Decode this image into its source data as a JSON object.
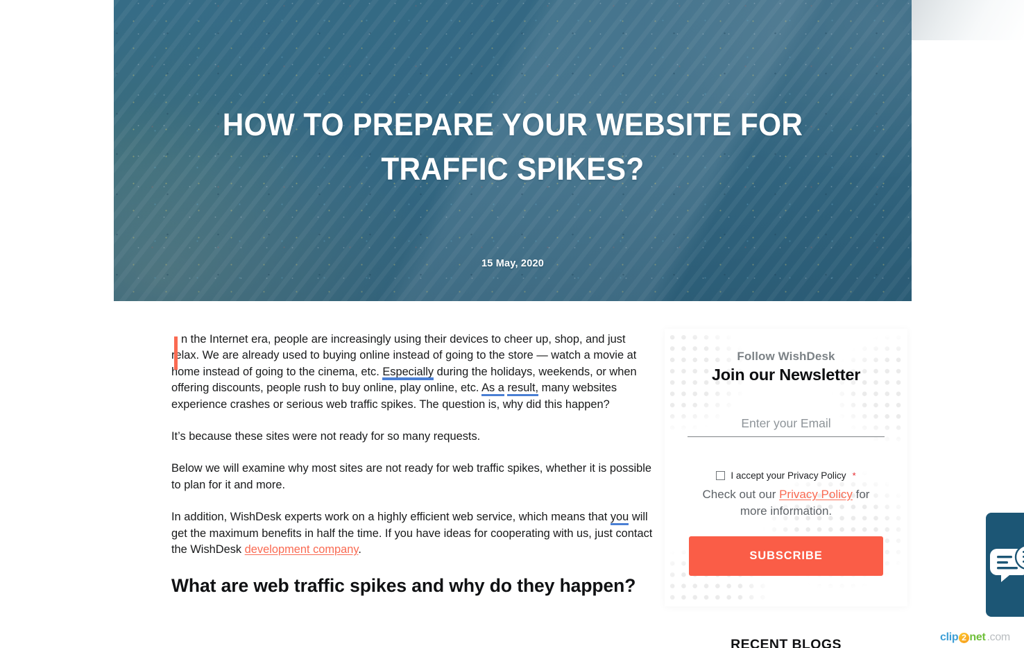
{
  "hero": {
    "title": "HOW TO PREPARE YOUR WEBSITE FOR TRAFFIC SPIKES?",
    "date": "15 May, 2020",
    "overlay_color": "#35718e"
  },
  "article": {
    "paragraphs": [
      {
        "id": "p1",
        "dropcap": "I",
        "segments": [
          {
            "text": "n the Internet era, people are increasingly using their devices to cheer up, shop, and just relax. We are already used to buying online instead of going to the store — watch a movie at home instead of going to the cinema, etc. "
          },
          {
            "text": "Especially",
            "style": "highlight-blue"
          },
          {
            "text": " during the holidays, weekends, or when offering discounts, people rush to buy online, play online, etc. "
          },
          {
            "text": "As a",
            "style": "highlight-blue"
          },
          {
            "text": " "
          },
          {
            "text": "result,",
            "style": "highlight-blue"
          },
          {
            "text": " many websites experience crashes or serious web traffic spikes. The question is, why did this happen?"
          }
        ]
      },
      {
        "id": "p2",
        "segments": [
          {
            "text": "It’s because these sites were not ready for so many requests."
          }
        ]
      },
      {
        "id": "p3",
        "segments": [
          {
            "text": "Below we will examine why most sites are not ready for web traffic spikes, whether it is possible to plan for it and more."
          }
        ]
      },
      {
        "id": "p4",
        "segments": [
          {
            "text": "In addition, WishDesk experts work on a highly efficient web service, which means that "
          },
          {
            "text": "you",
            "style": "highlight-blue"
          },
          {
            "text": " will get the maximum benefits in half the time. If you have ideas for cooperating with us, just contact the WishDesk "
          },
          {
            "text": "development company",
            "style": "link"
          },
          {
            "text": "."
          }
        ]
      }
    ],
    "section_heading": "What are web traffic spikes and why do they happen?",
    "link_color": "#fa6a52",
    "highlight_color": "#4a7fd4",
    "dropcap_color": "#fa6a52"
  },
  "sidebar": {
    "newsletter": {
      "eyebrow": "Follow WishDesk",
      "title": "Join our Newsletter",
      "email_placeholder": "Enter your Email",
      "email_value": "",
      "accept_label": "I accept your Privacy Policy",
      "accept_required_marker": "*",
      "accept_checked": false,
      "note_prefix": "Check out our ",
      "note_link": "Privacy Policy",
      "note_suffix": " for more information.",
      "subscribe_label": "SUBSCRIBE",
      "button_color": "#fa5d47"
    },
    "recent_blogs_title": "RECENT BLOGS"
  },
  "chat": {
    "panel_color": "#1c5675",
    "icon": "chat-bubble-icon"
  },
  "watermark": {
    "part1": "clip",
    "part2": "2",
    "part3": "net",
    "part4": ".com"
  }
}
